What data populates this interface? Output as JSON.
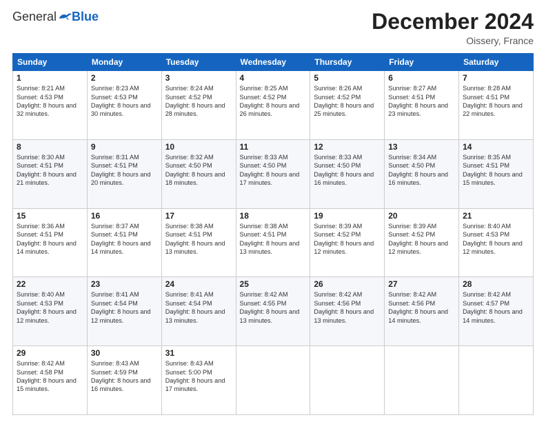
{
  "header": {
    "logo_general": "General",
    "logo_blue": "Blue",
    "month_title": "December 2024",
    "location": "Oissery, France"
  },
  "weekdays": [
    "Sunday",
    "Monday",
    "Tuesday",
    "Wednesday",
    "Thursday",
    "Friday",
    "Saturday"
  ],
  "weeks": [
    [
      {
        "day": 1,
        "sunrise": "8:21 AM",
        "sunset": "4:53 PM",
        "daylight": "8 hours and 32 minutes."
      },
      {
        "day": 2,
        "sunrise": "8:23 AM",
        "sunset": "4:53 PM",
        "daylight": "8 hours and 30 minutes."
      },
      {
        "day": 3,
        "sunrise": "8:24 AM",
        "sunset": "4:52 PM",
        "daylight": "8 hours and 28 minutes."
      },
      {
        "day": 4,
        "sunrise": "8:25 AM",
        "sunset": "4:52 PM",
        "daylight": "8 hours and 26 minutes."
      },
      {
        "day": 5,
        "sunrise": "8:26 AM",
        "sunset": "4:52 PM",
        "daylight": "8 hours and 25 minutes."
      },
      {
        "day": 6,
        "sunrise": "8:27 AM",
        "sunset": "4:51 PM",
        "daylight": "8 hours and 23 minutes."
      },
      {
        "day": 7,
        "sunrise": "8:28 AM",
        "sunset": "4:51 PM",
        "daylight": "8 hours and 22 minutes."
      }
    ],
    [
      {
        "day": 8,
        "sunrise": "8:30 AM",
        "sunset": "4:51 PM",
        "daylight": "8 hours and 21 minutes."
      },
      {
        "day": 9,
        "sunrise": "8:31 AM",
        "sunset": "4:51 PM",
        "daylight": "8 hours and 20 minutes."
      },
      {
        "day": 10,
        "sunrise": "8:32 AM",
        "sunset": "4:50 PM",
        "daylight": "8 hours and 18 minutes."
      },
      {
        "day": 11,
        "sunrise": "8:33 AM",
        "sunset": "4:50 PM",
        "daylight": "8 hours and 17 minutes."
      },
      {
        "day": 12,
        "sunrise": "8:33 AM",
        "sunset": "4:50 PM",
        "daylight": "8 hours and 16 minutes."
      },
      {
        "day": 13,
        "sunrise": "8:34 AM",
        "sunset": "4:50 PM",
        "daylight": "8 hours and 16 minutes."
      },
      {
        "day": 14,
        "sunrise": "8:35 AM",
        "sunset": "4:51 PM",
        "daylight": "8 hours and 15 minutes."
      }
    ],
    [
      {
        "day": 15,
        "sunrise": "8:36 AM",
        "sunset": "4:51 PM",
        "daylight": "8 hours and 14 minutes."
      },
      {
        "day": 16,
        "sunrise": "8:37 AM",
        "sunset": "4:51 PM",
        "daylight": "8 hours and 14 minutes."
      },
      {
        "day": 17,
        "sunrise": "8:38 AM",
        "sunset": "4:51 PM",
        "daylight": "8 hours and 13 minutes."
      },
      {
        "day": 18,
        "sunrise": "8:38 AM",
        "sunset": "4:51 PM",
        "daylight": "8 hours and 13 minutes."
      },
      {
        "day": 19,
        "sunrise": "8:39 AM",
        "sunset": "4:52 PM",
        "daylight": "8 hours and 12 minutes."
      },
      {
        "day": 20,
        "sunrise": "8:39 AM",
        "sunset": "4:52 PM",
        "daylight": "8 hours and 12 minutes."
      },
      {
        "day": 21,
        "sunrise": "8:40 AM",
        "sunset": "4:53 PM",
        "daylight": "8 hours and 12 minutes."
      }
    ],
    [
      {
        "day": 22,
        "sunrise": "8:40 AM",
        "sunset": "4:53 PM",
        "daylight": "8 hours and 12 minutes."
      },
      {
        "day": 23,
        "sunrise": "8:41 AM",
        "sunset": "4:54 PM",
        "daylight": "8 hours and 12 minutes."
      },
      {
        "day": 24,
        "sunrise": "8:41 AM",
        "sunset": "4:54 PM",
        "daylight": "8 hours and 13 minutes."
      },
      {
        "day": 25,
        "sunrise": "8:42 AM",
        "sunset": "4:55 PM",
        "daylight": "8 hours and 13 minutes."
      },
      {
        "day": 26,
        "sunrise": "8:42 AM",
        "sunset": "4:56 PM",
        "daylight": "8 hours and 13 minutes."
      },
      {
        "day": 27,
        "sunrise": "8:42 AM",
        "sunset": "4:56 PM",
        "daylight": "8 hours and 14 minutes."
      },
      {
        "day": 28,
        "sunrise": "8:42 AM",
        "sunset": "4:57 PM",
        "daylight": "8 hours and 14 minutes."
      }
    ],
    [
      {
        "day": 29,
        "sunrise": "8:42 AM",
        "sunset": "4:58 PM",
        "daylight": "8 hours and 15 minutes."
      },
      {
        "day": 30,
        "sunrise": "8:43 AM",
        "sunset": "4:59 PM",
        "daylight": "8 hours and 16 minutes."
      },
      {
        "day": 31,
        "sunrise": "8:43 AM",
        "sunset": "5:00 PM",
        "daylight": "8 hours and 17 minutes."
      },
      null,
      null,
      null,
      null
    ]
  ]
}
